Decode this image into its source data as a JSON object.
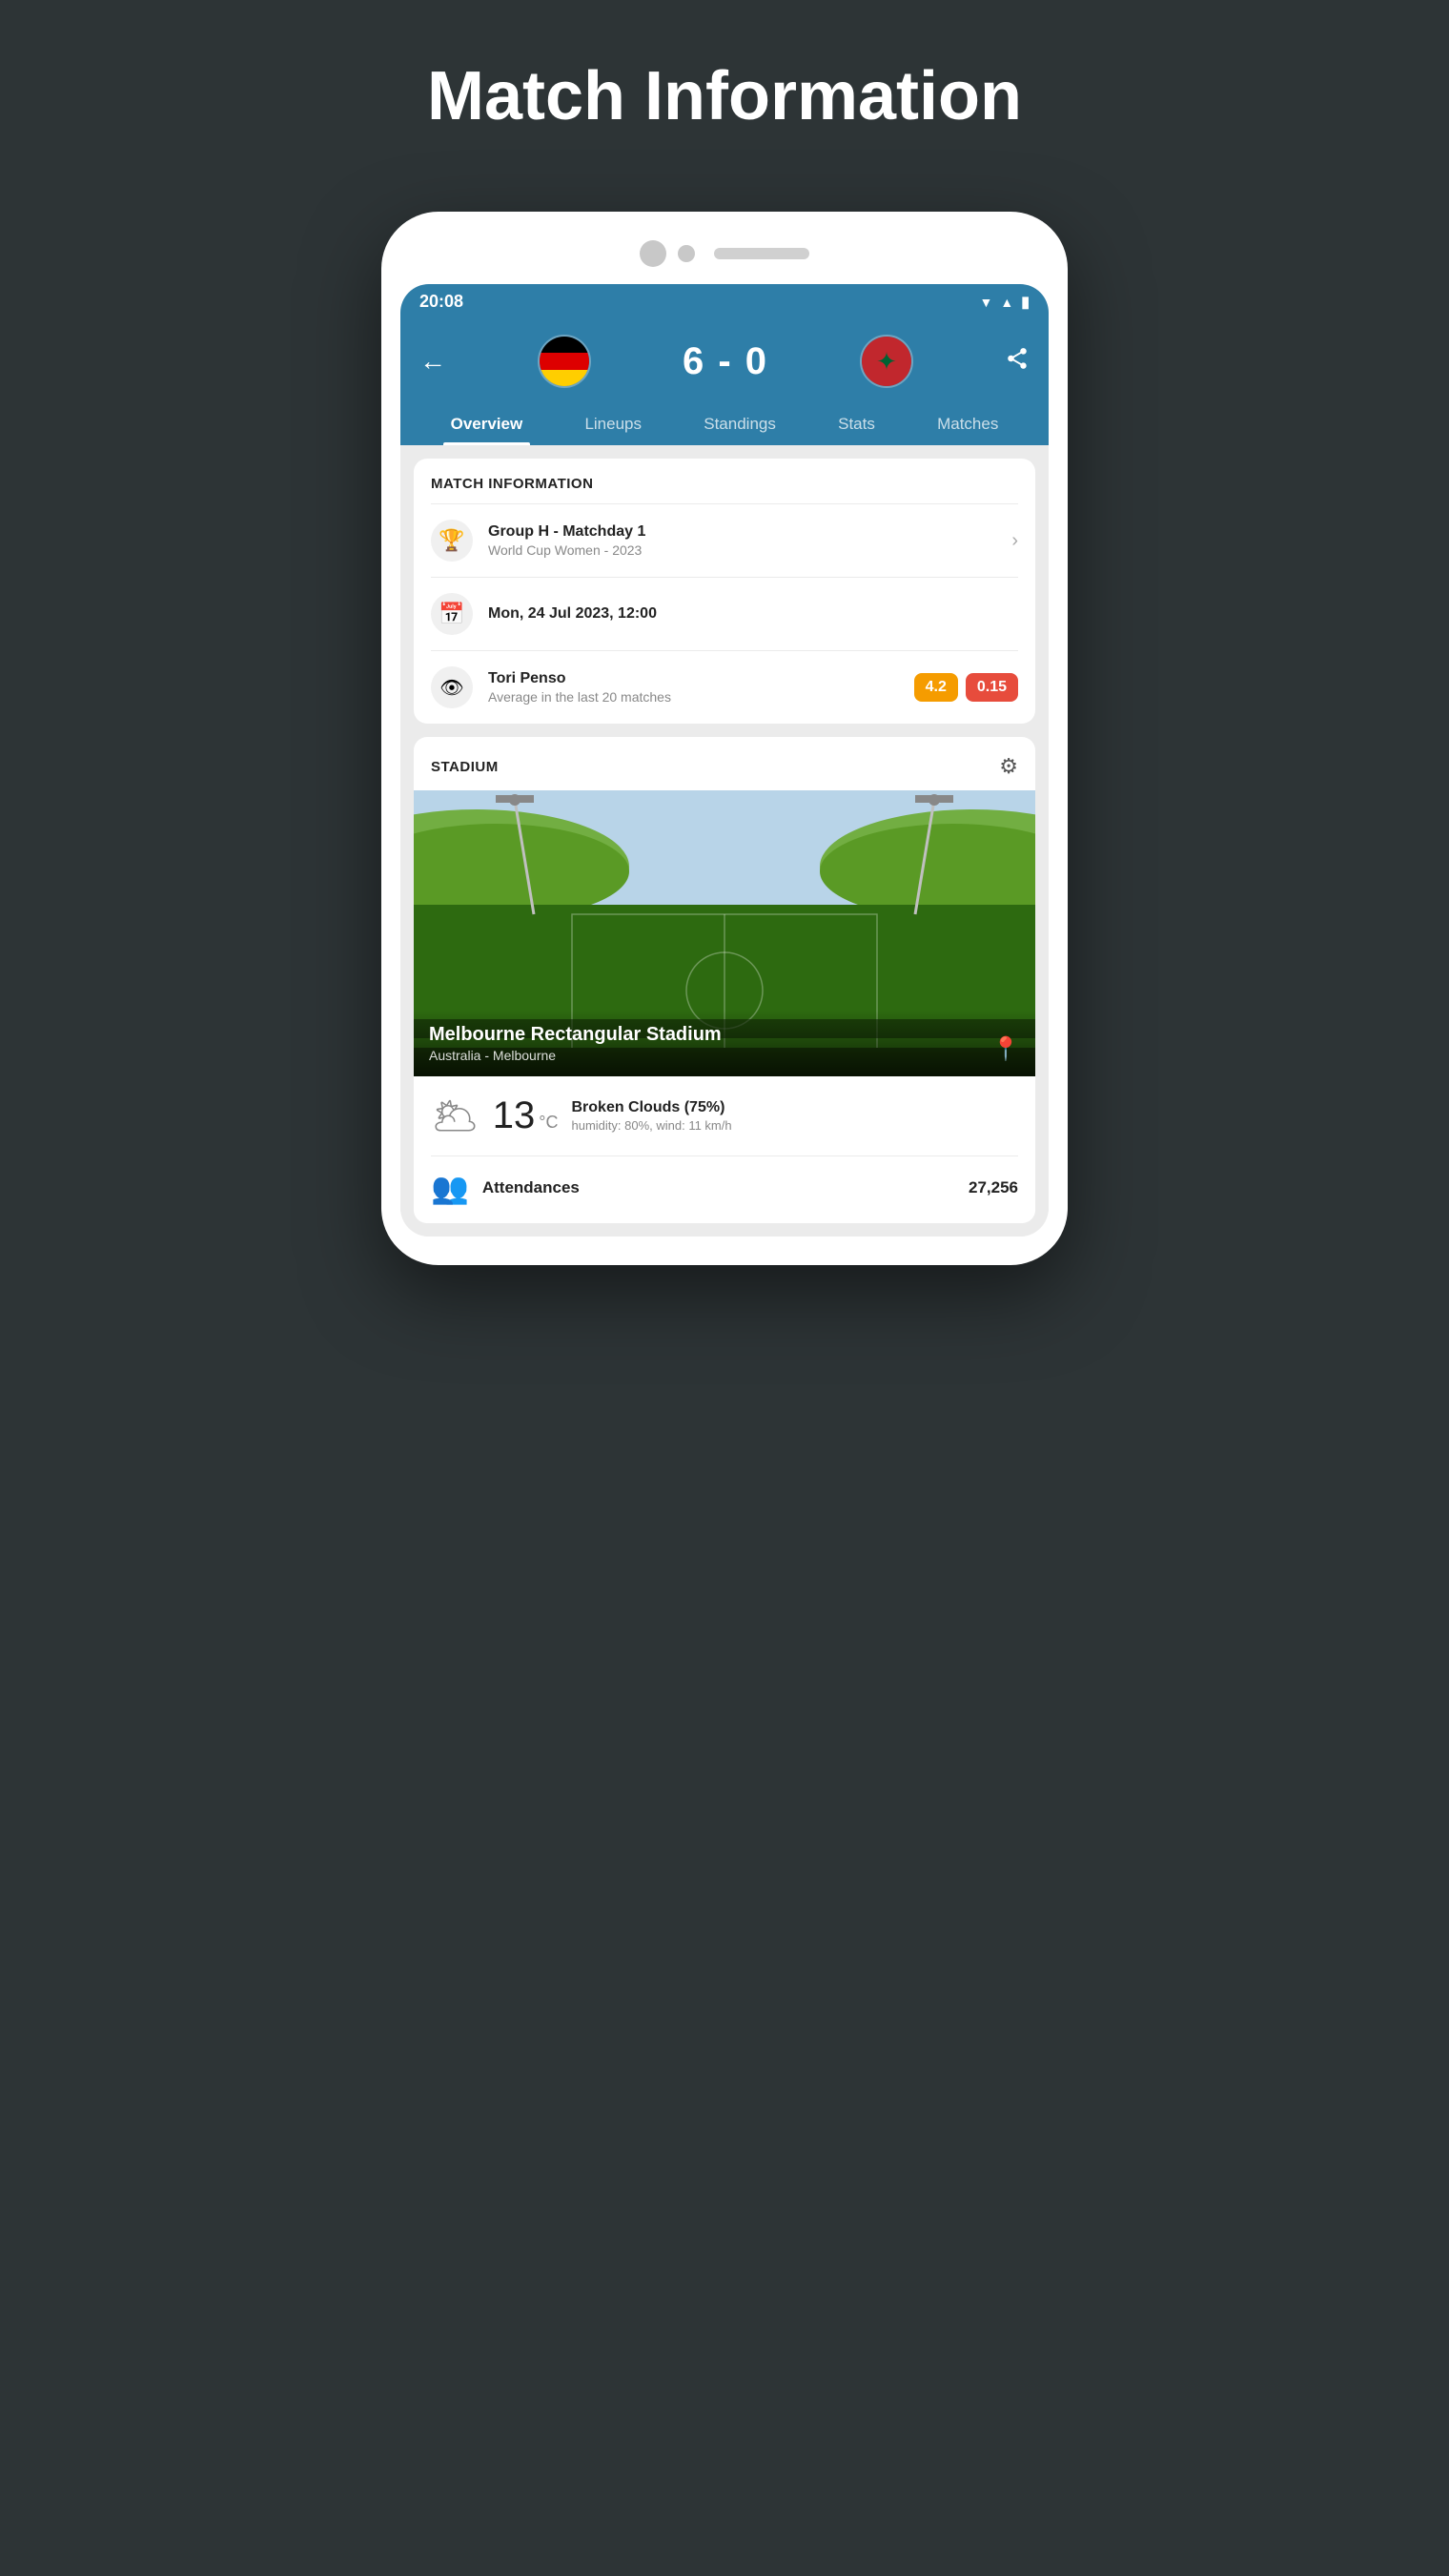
{
  "page": {
    "title": "Match Information"
  },
  "status_bar": {
    "time": "20:08"
  },
  "header": {
    "score": "6 - 0",
    "back_label": "←",
    "share_label": "⤴"
  },
  "tabs": [
    {
      "id": "overview",
      "label": "Overview",
      "active": true
    },
    {
      "id": "lineups",
      "label": "Lineups",
      "active": false
    },
    {
      "id": "standings",
      "label": "Standings",
      "active": false
    },
    {
      "id": "stats",
      "label": "Stats",
      "active": false
    },
    {
      "id": "matches",
      "label": "Matches",
      "active": false
    }
  ],
  "match_info": {
    "section_title": "MATCH INFORMATION",
    "competition": {
      "name": "Group H - Matchday 1",
      "sub": "World Cup Women - 2023"
    },
    "date": "Mon, 24 Jul 2023, 12:00",
    "referee": {
      "name": "Tori Penso",
      "sub": "Average in the last 20 matches",
      "badge1": "4.2",
      "badge2": "0.15"
    }
  },
  "stadium": {
    "section_title": "STADIUM",
    "name": "Melbourne Rectangular Stadium",
    "location": "Australia - Melbourne"
  },
  "weather": {
    "temp": "13",
    "unit": "°C",
    "description": "Broken Clouds (75%)",
    "details": "humidity: 80%, wind: 11 km/h"
  },
  "attendance": {
    "label": "Attendances",
    "value": "27,256"
  }
}
